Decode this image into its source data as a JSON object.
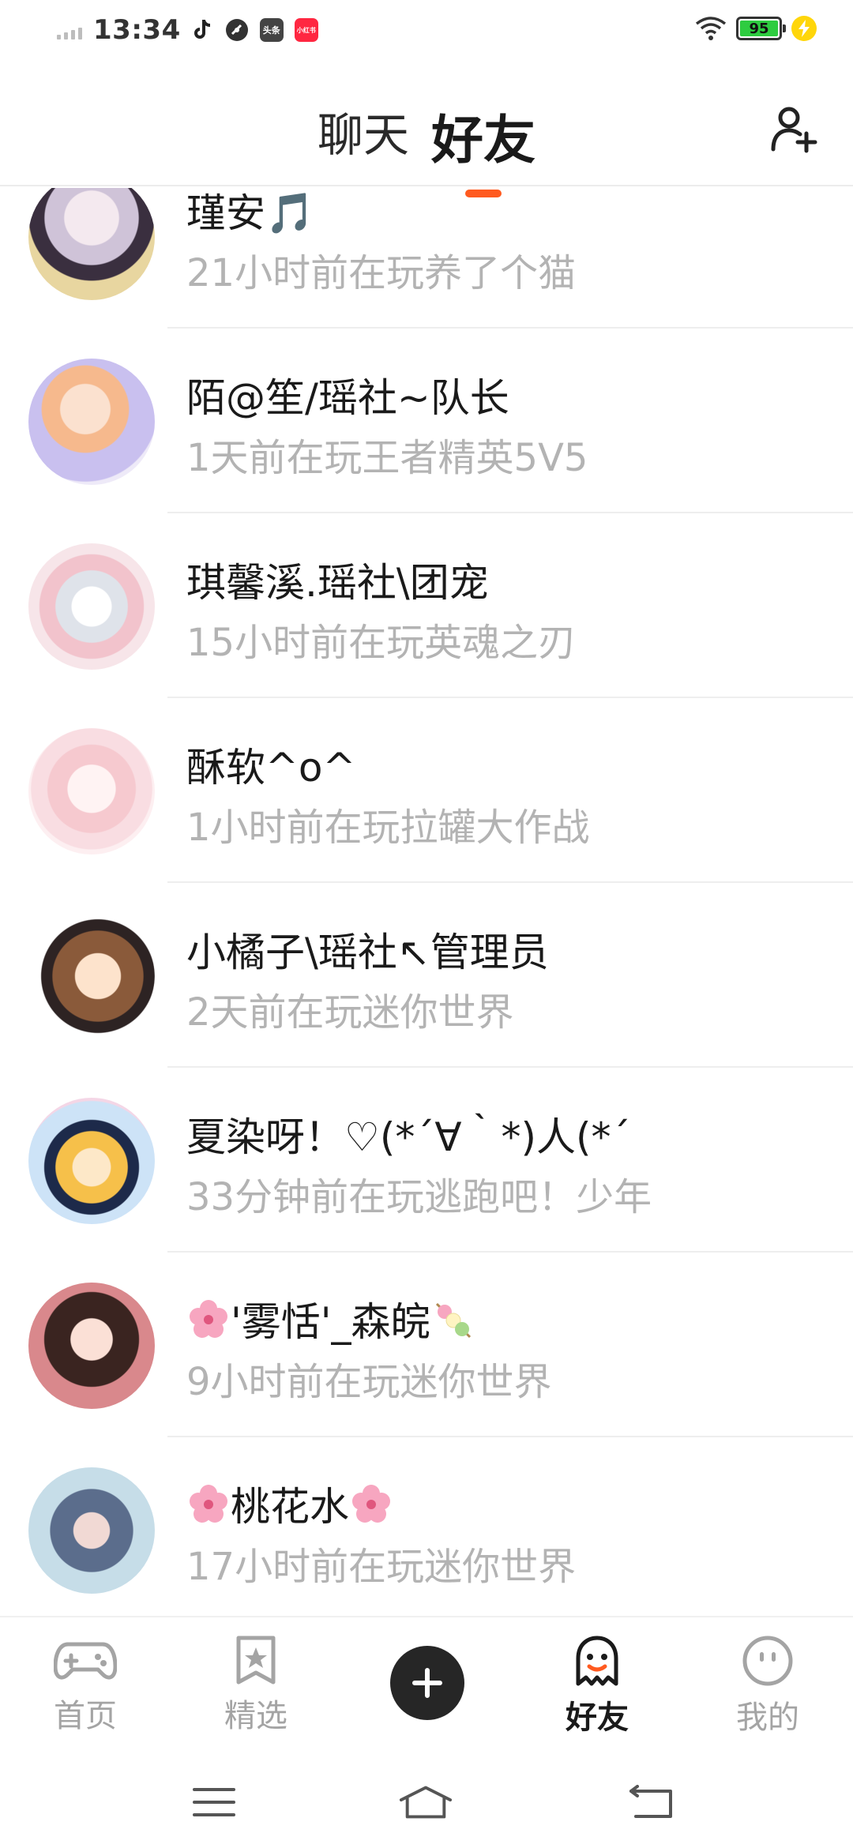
{
  "status_bar": {
    "time": "13:34",
    "battery": "95",
    "notification_icons": [
      "tiktok-icon",
      "gauge-icon",
      "toutiao-icon",
      "xiaohongshu-icon"
    ],
    "toutiao_label": "头条",
    "xiaohongshu_label": "小红书"
  },
  "header": {
    "tabs": [
      {
        "label": "聊天",
        "active": false
      },
      {
        "label": "好友",
        "active": true
      }
    ],
    "accent_color": "#ff5a1f"
  },
  "friends": [
    {
      "name": "瑾安🎵",
      "status": "21小时前在玩养了个猫"
    },
    {
      "name": "陌@笙/瑶社~队长",
      "status": "1天前在玩王者精英5V5"
    },
    {
      "name": "琪馨溪.瑶社\\团宠",
      "status": "15小时前在玩英魂之刃"
    },
    {
      "name": "酥软^o^",
      "status": "1小时前在玩拉罐大作战"
    },
    {
      "name": "小橘子\\瑶社↖管理员",
      "status": "2天前在玩迷你世界"
    },
    {
      "name": "夏染呀！♡(*´∀｀*)人(*´",
      "status": "33分钟前在玩逃跑吧！少年"
    },
    {
      "name": "'雾恬'_森皖",
      "status": "9小时前在玩迷你世界"
    },
    {
      "name": "桃花水",
      "status": "17小时前在玩迷你世界"
    }
  ],
  "bottom_nav": {
    "items": [
      {
        "label": "首页",
        "icon": "gamepad-icon"
      },
      {
        "label": "精选",
        "icon": "star-bookmark-icon"
      },
      {
        "label": "好友",
        "icon": "ghost-icon",
        "active": true
      },
      {
        "label": "我的",
        "icon": "face-icon"
      }
    ],
    "center_icon": "plus-icon"
  },
  "system_nav": {
    "icons": [
      "menu-icon",
      "home-icon",
      "back-icon"
    ]
  }
}
